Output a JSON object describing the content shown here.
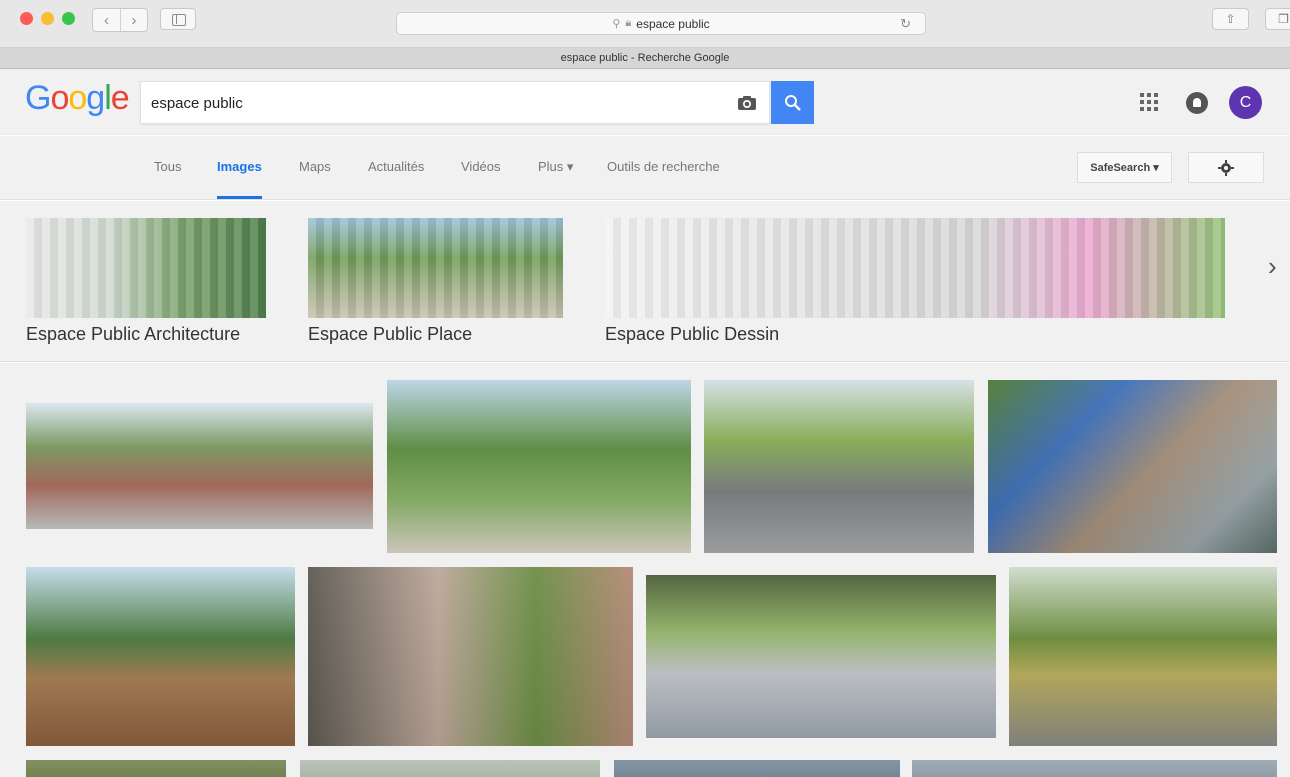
{
  "browser": {
    "address": "espace public",
    "tab_title": "espace public - Recherche Google"
  },
  "google": {
    "logo_letters": [
      "G",
      "o",
      "o",
      "g",
      "l",
      "e"
    ],
    "logo_colors": [
      "#4285f4",
      "#ea4335",
      "#fbbc05",
      "#4285f4",
      "#34a853",
      "#ea4335"
    ],
    "query": "espace public",
    "avatar_initial": "C"
  },
  "nav": {
    "tabs": [
      {
        "label": "Tous"
      },
      {
        "label": "Images"
      },
      {
        "label": "Maps"
      },
      {
        "label": "Actualités"
      },
      {
        "label": "Vidéos"
      },
      {
        "label": "Plus ▾"
      },
      {
        "label": "Outils de recherche"
      }
    ],
    "safesearch": "SafeSearch ▾"
  },
  "related": [
    {
      "label": "Espace Public Architecture"
    },
    {
      "label": "Espace Public Place"
    },
    {
      "label": "Espace Public Dessin"
    }
  ],
  "results": [
    {
      "alt": "place publique"
    },
    {
      "alt": "esplanade arborée"
    },
    {
      "alt": "place avec arbres"
    },
    {
      "alt": "berges aménagées"
    },
    {
      "alt": "gradins en bois"
    },
    {
      "alt": "allée arborée avec bancs"
    },
    {
      "alt": "parvis avec promeneurs"
    },
    {
      "alt": "promenade plantée"
    }
  ]
}
